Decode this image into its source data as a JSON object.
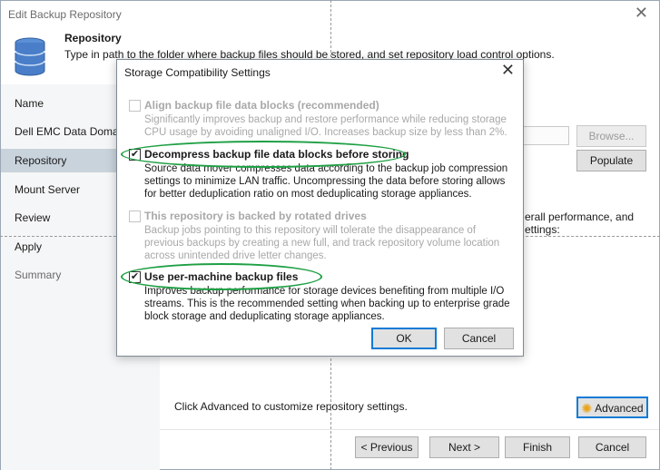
{
  "window": {
    "title": "Edit Backup Repository",
    "close_glyph": "✕"
  },
  "header": {
    "icon": "database-icon",
    "title": "Repository",
    "description": "Type in path to the folder where backup files should be stored, and set repository load control options."
  },
  "sidebar": {
    "steps": [
      {
        "label": "Name",
        "state": "normal"
      },
      {
        "label": "Dell EMC Data Domain",
        "state": "normal"
      },
      {
        "label": "Repository",
        "state": "active"
      },
      {
        "label": "Mount Server",
        "state": "normal"
      },
      {
        "label": "Review",
        "state": "normal"
      },
      {
        "label": "Apply",
        "state": "normal"
      },
      {
        "label": "Summary",
        "state": "muted"
      }
    ]
  },
  "main": {
    "browse_label": "Browse...",
    "populate_label": "Populate",
    "partial_text_1": "erall performance, and",
    "partial_text_2": "ettings:",
    "advanced_hint": "Click Advanced to customize repository settings.",
    "advanced_label": "Advanced"
  },
  "footer": {
    "previous_label": "< Previous",
    "next_label": "Next >",
    "finish_label": "Finish",
    "cancel_label": "Cancel"
  },
  "modal": {
    "title": "Storage Compatibility Settings",
    "close_glyph": "✕",
    "options": [
      {
        "label": "Align backup file data blocks (recommended)",
        "description": "Significantly improves backup and restore performance while reducing storage CPU usage by avoiding unaligned I/O. Increases backup size by less than 2%.",
        "checked": false,
        "enabled": false,
        "highlighted": false
      },
      {
        "label": "Decompress backup file data blocks before storing",
        "description": "Source data mover compresses data according to the backup job compression settings to minimize LAN traffic. Uncompressing the data before storing allows for better deduplication ratio on most deduplicating storage appliances.",
        "checked": true,
        "enabled": true,
        "highlighted": true
      },
      {
        "label": "This repository is backed by rotated drives",
        "description": "Backup jobs pointing to this repository will tolerate the disappearance of previous backups by creating a new full, and track repository volume location across unintended drive letter changes.",
        "checked": false,
        "enabled": false,
        "highlighted": false
      },
      {
        "label": "Use per-machine backup files",
        "description": "Improves backup performance for storage devices benefiting from multiple I/O streams. This is the recommended setting when backing up to enterprise grade block storage and deduplicating storage appliances.",
        "checked": true,
        "enabled": true,
        "highlighted": true
      }
    ],
    "ok_label": "OK",
    "cancel_label": "Cancel"
  },
  "colors": {
    "highlight_ellipse": "#1fa045",
    "active_step": "#c9d3dc",
    "sidebar_bg": "#f5f6f7",
    "primary_border": "#0f7bd6",
    "gear": "#e8a317"
  }
}
